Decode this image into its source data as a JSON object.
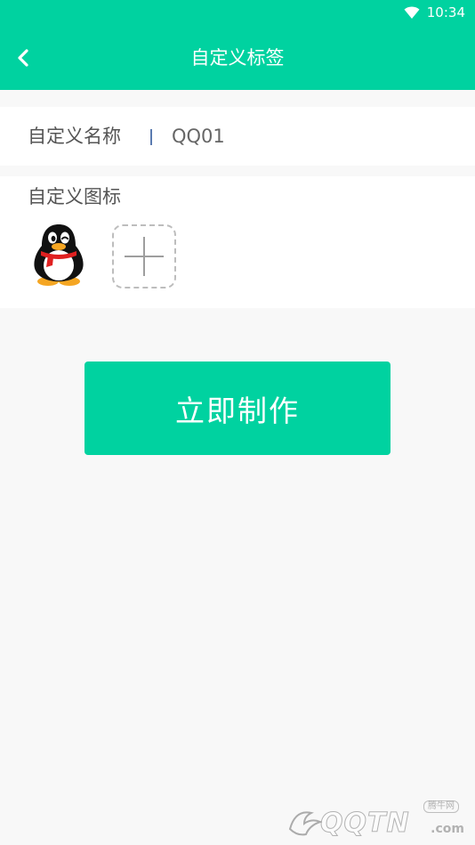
{
  "status_bar": {
    "time": "10:34",
    "icons": [
      "wifi-icon"
    ]
  },
  "toolbar": {
    "title": "自定义标签",
    "back_icon": "chevron-left-icon"
  },
  "name_field": {
    "label": "自定义名称",
    "value": "QQ01",
    "placeholder": ""
  },
  "icon_field": {
    "label": "自定义图标",
    "selected_icon": "qq-penguin-icon",
    "add_icon": "plus-icon"
  },
  "action": {
    "label": "立即制作"
  },
  "watermark": {
    "small_text": "腾牛网",
    "main_text": "QQTN",
    "suffix": ".com"
  },
  "colors": {
    "accent": "#00d2a0",
    "background": "#f8f8f8",
    "surface": "#ffffff",
    "label_text": "#555555"
  }
}
